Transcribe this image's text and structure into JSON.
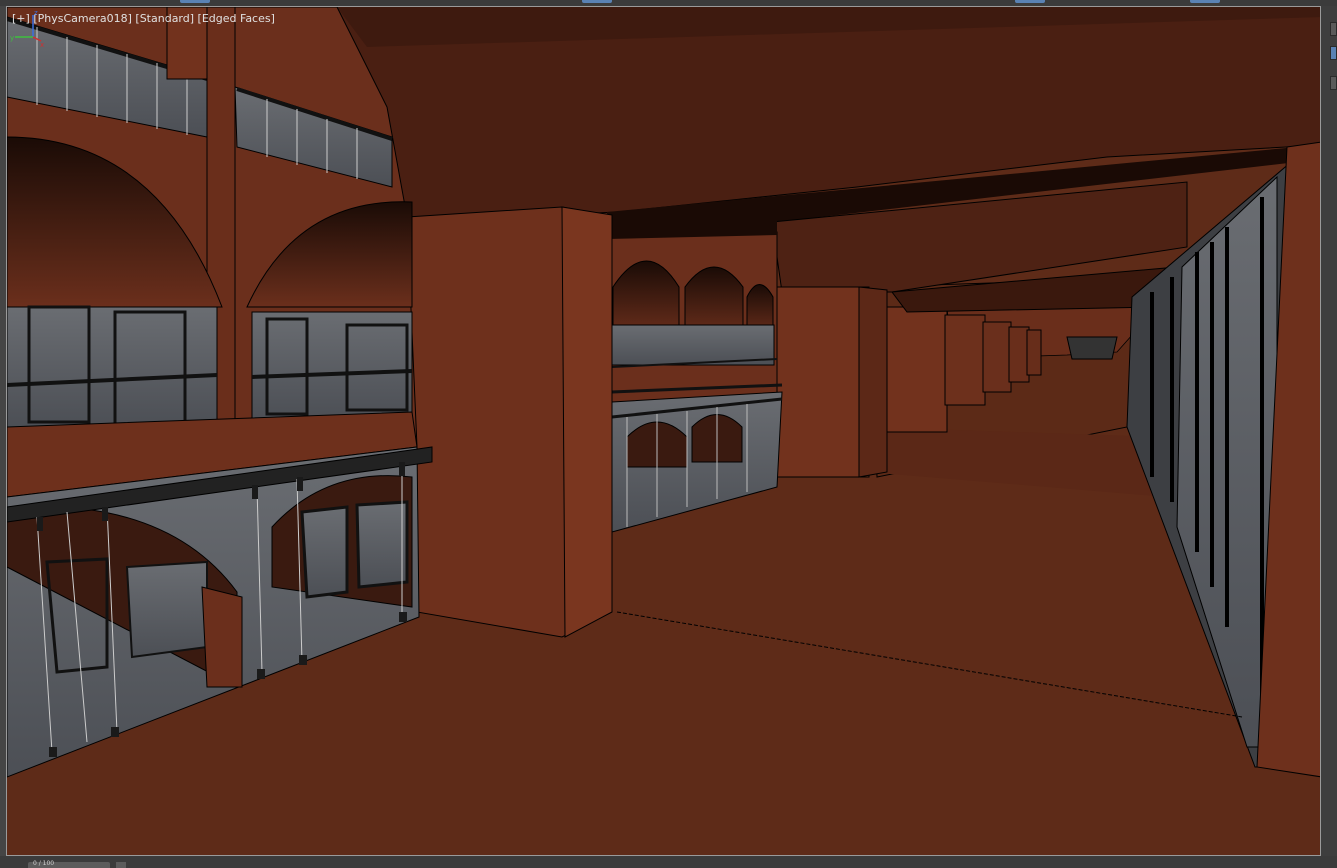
{
  "viewport": {
    "label_plus": "[+]",
    "label_camera": "[PhysCamera018]",
    "label_shading": "[Standard]",
    "label_display": "[Edged Faces]",
    "axis_x": "x",
    "axis_y": "y",
    "axis_z": "z"
  },
  "bottom": {
    "tab_label": "0 / 100"
  },
  "colors": {
    "floor": "#5e2b18",
    "wall": "#6b2f1c",
    "pillar": "#72321d",
    "ceiling": "#4a1f12",
    "glass": "#5a5f66",
    "accent": "#5a82b4"
  },
  "icons": {
    "axis_gizmo": "axis-gizmo-icon"
  }
}
